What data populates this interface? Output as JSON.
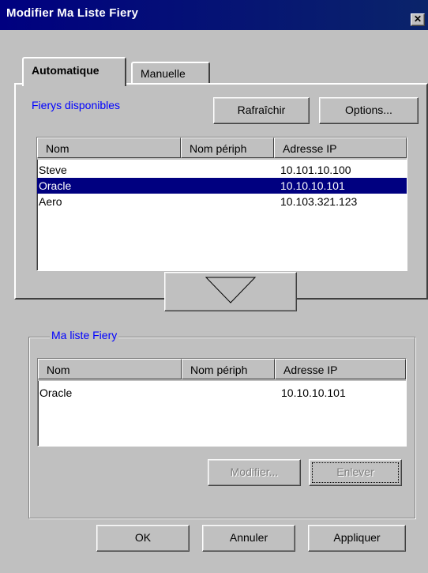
{
  "window": {
    "title": "Modifier Ma Liste Fiery",
    "close_glyph": "✕"
  },
  "tabs": [
    {
      "label": "Automatique",
      "active": true
    },
    {
      "label": "Manuelle",
      "active": false
    }
  ],
  "available": {
    "label": "Fierys disponibles",
    "refresh_button": "Rafraîchir",
    "options_button": "Options...",
    "columns": [
      "Nom",
      "Nom périph",
      "Adresse IP"
    ],
    "rows": [
      {
        "name": "Steve",
        "device": "",
        "ip": "10.101.10.100",
        "selected": false
      },
      {
        "name": "Oracle",
        "device": "",
        "ip": "10.10.10.101",
        "selected": true
      },
      {
        "name": "Aero",
        "device": "",
        "ip": "10.103.321.123",
        "selected": false
      }
    ]
  },
  "add_arrow": {
    "icon": "triangle-down-icon"
  },
  "my_list": {
    "label": "Ma liste Fiery",
    "columns": [
      "Nom",
      "Nom périph",
      "Adresse IP"
    ],
    "rows": [
      {
        "name": "Oracle",
        "device": "",
        "ip": "10.10.10.101"
      }
    ],
    "modify_button": "Modifier...",
    "remove_button": "Enlever"
  },
  "footer": {
    "ok_button": "OK",
    "cancel_button": "Annuler",
    "apply_button": "Appliquer"
  },
  "colors": {
    "title_bar": "#000080",
    "selection": "#000080",
    "label_blue": "#0000ff",
    "face": "#c0c0c0"
  }
}
